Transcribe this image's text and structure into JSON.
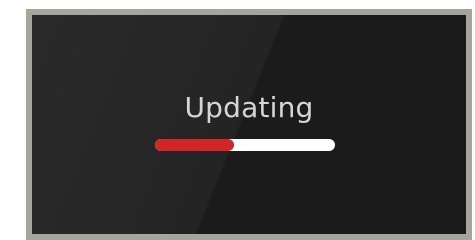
{
  "screen": {
    "title": "Updating",
    "progress_fraction": 0.44
  },
  "colors": {
    "frame": "#a7a59a",
    "screen_bg": "#1b1b1b",
    "text": "#d6d6d6",
    "progress_fill": "#d1252a",
    "progress_track": "#ffffff"
  }
}
